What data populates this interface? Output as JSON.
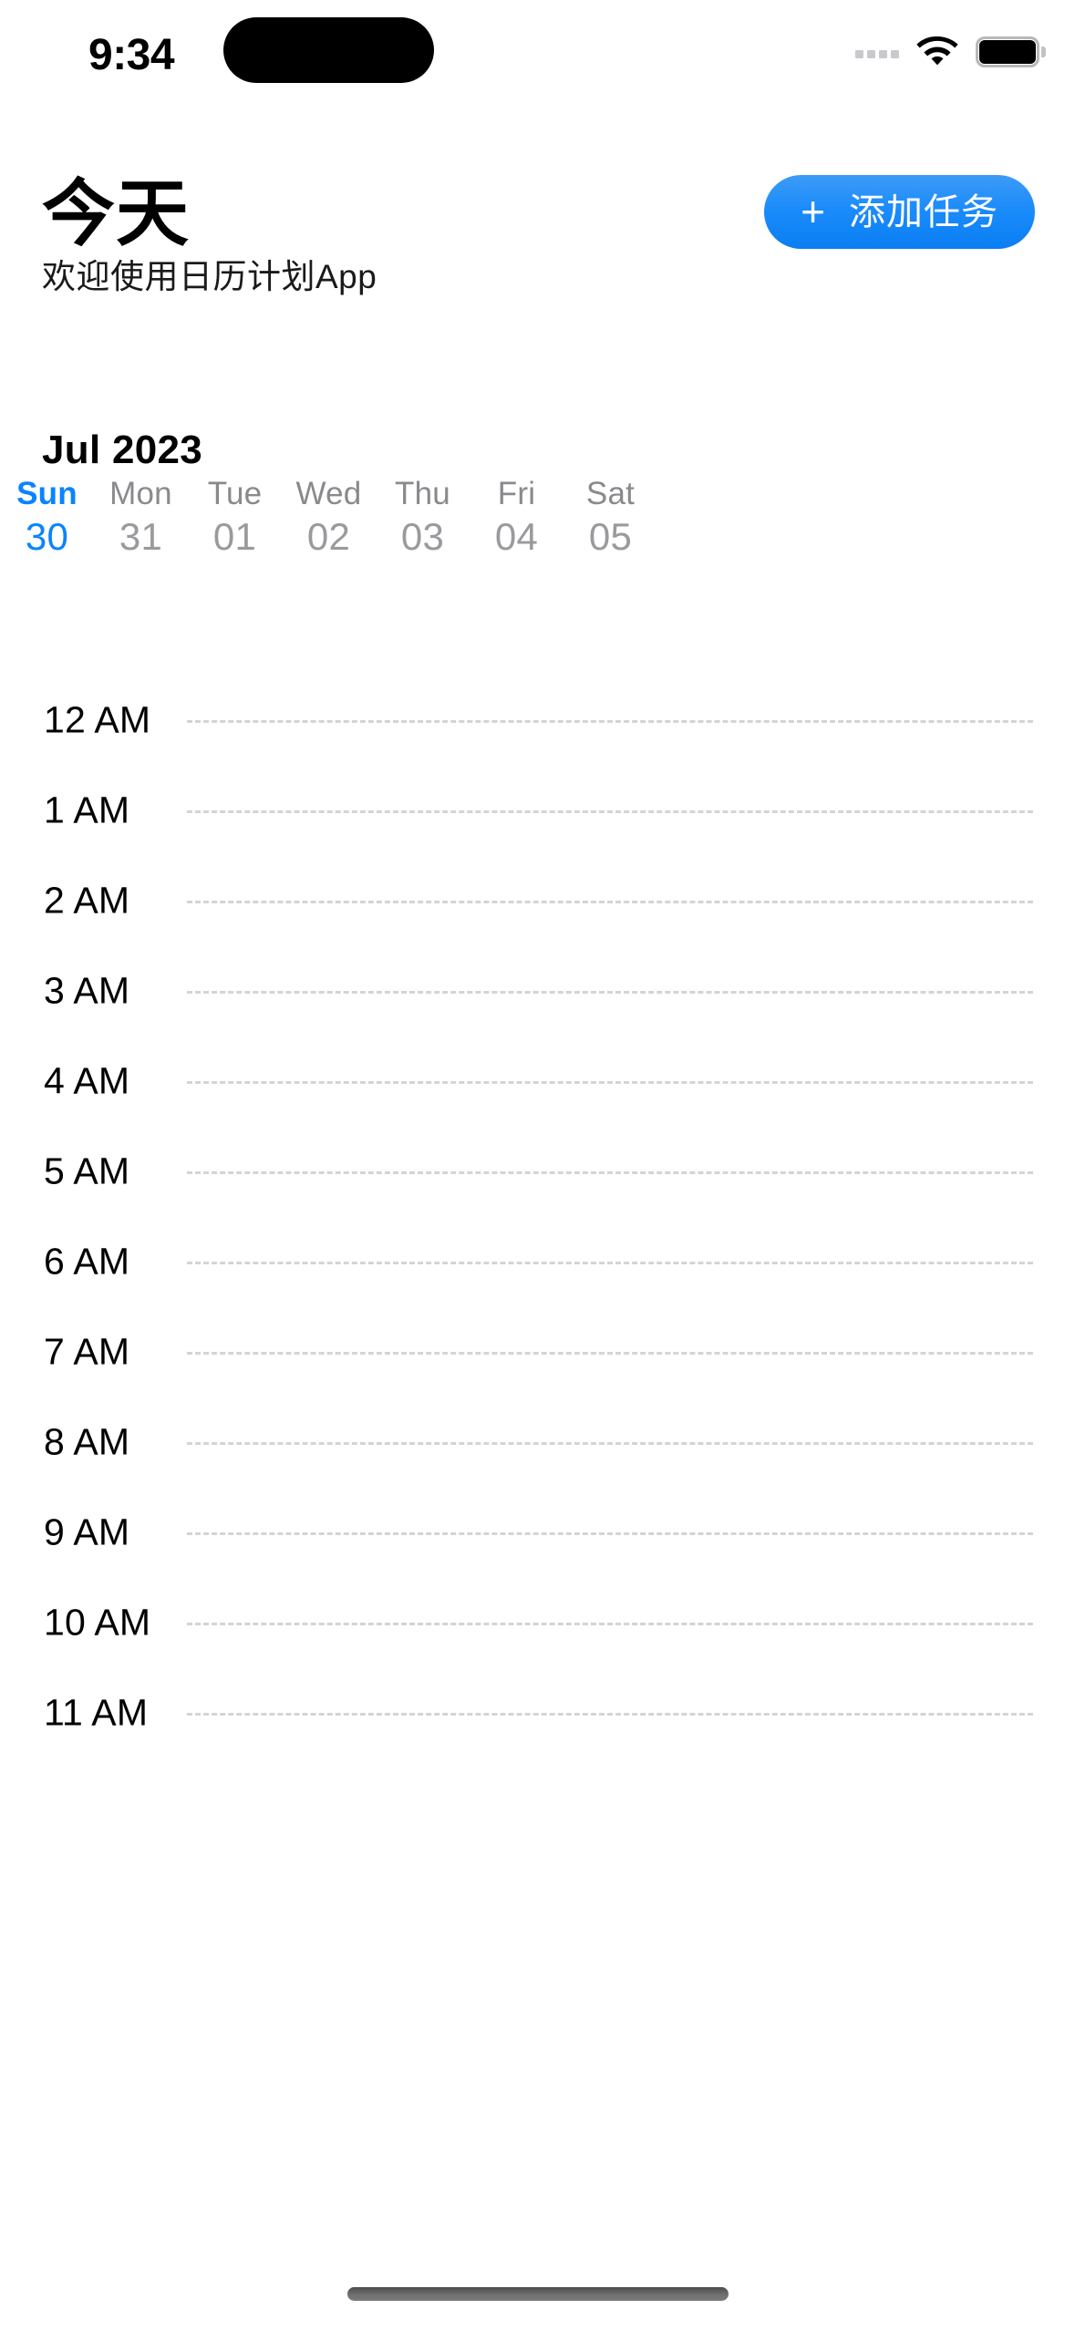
{
  "status_bar": {
    "time": "9:34",
    "signal_icon": "signal-dots-icon",
    "wifi_icon": "wifi-icon",
    "battery_icon": "battery-full-icon"
  },
  "header": {
    "title": "今天",
    "subtitle": "欢迎使用日历计划App",
    "add_task_button": {
      "plus": "+",
      "label": "添加任务",
      "bg_color_top": "#3d9bf7",
      "bg_color_bottom": "#0a7ef2",
      "text_color": "#ffffff"
    }
  },
  "calendar": {
    "month_label": "Jul 2023",
    "accent_color": "#0a84ff",
    "inactive_color": "#8a8a8e",
    "days": [
      {
        "name": "Sun",
        "num": "30",
        "today": true
      },
      {
        "name": "Mon",
        "num": "31",
        "today": false
      },
      {
        "name": "Tue",
        "num": "01",
        "today": false
      },
      {
        "name": "Wed",
        "num": "02",
        "today": false
      },
      {
        "name": "Thu",
        "num": "03",
        "today": false
      },
      {
        "name": "Fri",
        "num": "04",
        "today": false
      },
      {
        "name": "Sat",
        "num": "05",
        "today": false
      }
    ],
    "hours": [
      {
        "label": "12 AM"
      },
      {
        "label": "1 AM"
      },
      {
        "label": "2 AM"
      },
      {
        "label": "3 AM"
      },
      {
        "label": "4 AM"
      },
      {
        "label": "5 AM"
      },
      {
        "label": "6 AM"
      },
      {
        "label": "7 AM"
      },
      {
        "label": "8 AM"
      },
      {
        "label": "9 AM"
      },
      {
        "label": "10 AM"
      },
      {
        "label": "11 AM"
      }
    ],
    "gridline_color": "#d4d4d6",
    "events": []
  },
  "home_indicator": {
    "name": "home-indicator"
  }
}
